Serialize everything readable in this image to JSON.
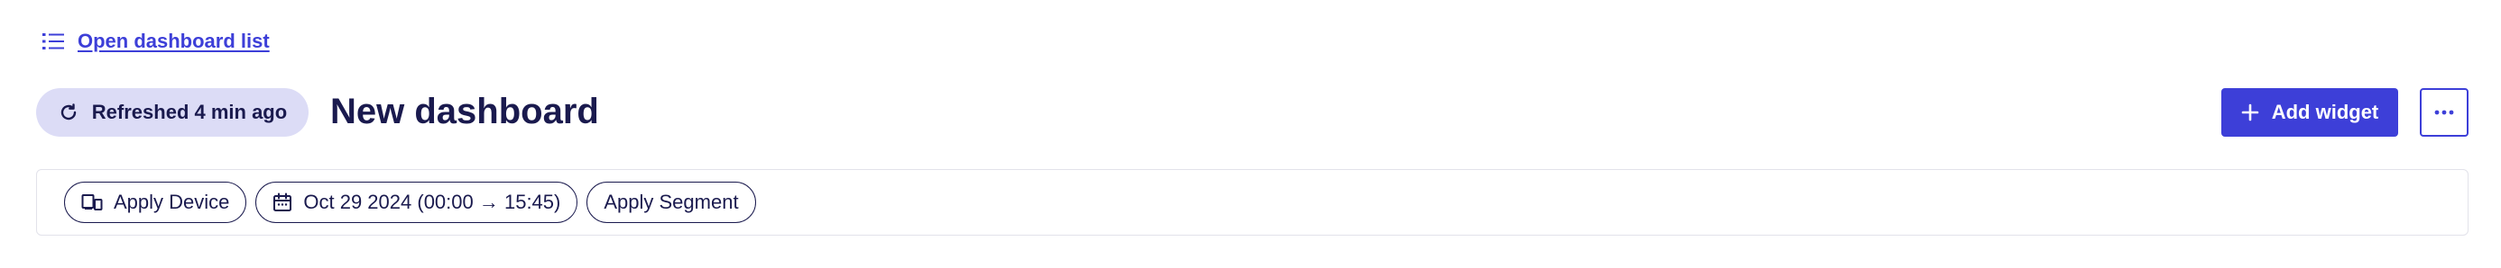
{
  "header": {
    "dashboard_list_link": "Open dashboard list",
    "refresh_status": "Refreshed 4 min ago",
    "title": "New dashboard",
    "add_widget_label": "Add widget",
    "more_icon": "ellipsis-icon"
  },
  "filters": {
    "device": {
      "label": "Apply Device",
      "icon": "devices-icon"
    },
    "date": {
      "label": "Oct 29 2024 (00:00 → 15:45)",
      "icon": "calendar-icon"
    },
    "segment": {
      "label": "Apply Segment"
    }
  },
  "colors": {
    "primary": "#3d3fd8",
    "text_dark": "#1a1a4e",
    "pill_bg": "#dcdcf6",
    "border_light": "#e2e2ea"
  }
}
